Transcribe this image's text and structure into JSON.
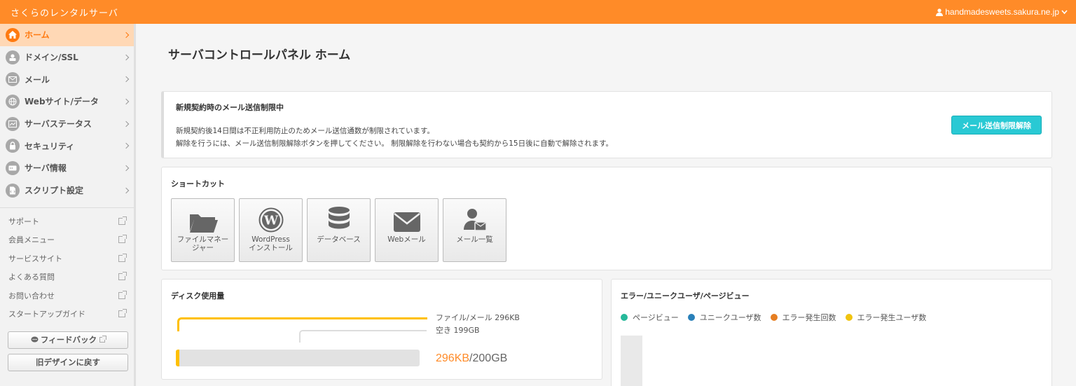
{
  "header": {
    "brand": "さくらのレンタルサーバ",
    "user": "handmadesweets.sakura.ne.jp"
  },
  "sidebar": {
    "nav": [
      {
        "label": "ホーム",
        "icon": "home-icon",
        "active": true
      },
      {
        "label": "ドメイン/SSL",
        "icon": "domain-icon"
      },
      {
        "label": "メール",
        "icon": "mail-icon"
      },
      {
        "label": "Webサイト/データ",
        "icon": "globe-icon"
      },
      {
        "label": "サーバステータス",
        "icon": "chart-icon"
      },
      {
        "label": "セキュリティ",
        "icon": "lock-icon"
      },
      {
        "label": "サーバ情報",
        "icon": "server-icon"
      },
      {
        "label": "スクリプト設定",
        "icon": "script-icon"
      }
    ],
    "links": [
      "サポート",
      "会員メニュー",
      "サービスサイト",
      "よくある質問",
      "お問い合わせ",
      "スタートアップガイド"
    ],
    "feedback_label": "フィードバック",
    "old_design_label": "旧デザインに戻す"
  },
  "main": {
    "title": "サーバコントロールパネル ホーム",
    "notice": {
      "title": "新規契約時のメール送信制限中",
      "line1": "新規契約後14日間は不正利用防止のためメール送信通数が制限されています。",
      "line2": "解除を行うには、メール送信制限解除ボタンを押してください。 制限解除を行わない場合も契約から15日後に自動で解除されます。",
      "button": "メール送信制限解除"
    },
    "shortcuts": {
      "title": "ショートカット",
      "items": [
        {
          "label": "ファイルマネー\nジャー",
          "icon": "folder-icon"
        },
        {
          "label": "WordPress\nインストール",
          "icon": "wordpress-icon"
        },
        {
          "label": "データベース",
          "icon": "database-icon"
        },
        {
          "label": "Webメール",
          "icon": "envelope-icon"
        },
        {
          "label": "メール一覧",
          "icon": "user-mail-icon"
        }
      ]
    },
    "disk": {
      "title": "ディスク使用量",
      "used_label": "ファイル/メール 296KB",
      "free_label": "空き 199GB",
      "used": "296KB",
      "total": "/200GB",
      "used_fraction": 1.5e-06,
      "used_color": "#ffc000"
    },
    "stats": {
      "title": "エラー/ユニークユーザ/ページビュー",
      "legend": [
        {
          "label": "ページビュー",
          "color": "#26b99a"
        },
        {
          "label": "ユニークユーザ数",
          "color": "#2980b9"
        },
        {
          "label": "エラー発生回数",
          "color": "#e67e22"
        },
        {
          "label": "エラー発生ユーザ数",
          "color": "#f1c40f"
        }
      ]
    }
  }
}
